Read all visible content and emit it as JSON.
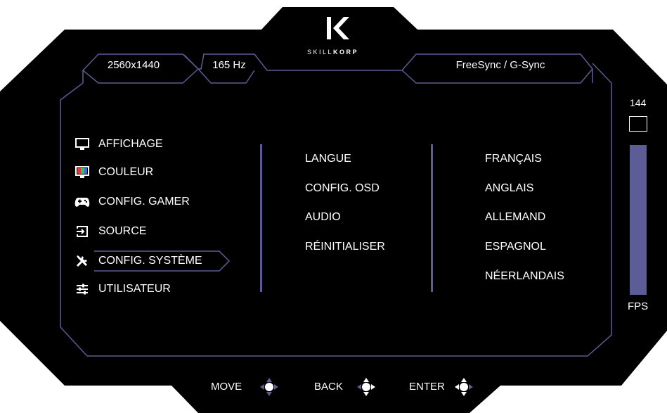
{
  "brand": {
    "name": "SKILLKORP",
    "prefix": "SKILL",
    "suffix": "KORP",
    "logo_letter": "K"
  },
  "status": {
    "resolution": "2560x1440",
    "refresh_rate": "165 Hz",
    "sync": "FreeSync / G-Sync"
  },
  "fps": {
    "max_label": "144",
    "unit_label": "FPS",
    "level": 0.92
  },
  "menu": {
    "items": [
      {
        "label": "AFFICHAGE",
        "icon": "monitor-icon"
      },
      {
        "label": "COULEUR",
        "icon": "color-icon"
      },
      {
        "label": "CONFIG. GAMER",
        "icon": "gamepad-icon"
      },
      {
        "label": "SOURCE",
        "icon": "source-icon"
      },
      {
        "label": "CONFIG. SYSTÈME",
        "icon": "tools-icon",
        "selected": true
      },
      {
        "label": "UTILISATEUR",
        "icon": "sliders-icon"
      }
    ]
  },
  "submenu": {
    "items": [
      "LANGUE",
      "CONFIG. OSD",
      "AUDIO",
      "RÉINITIALISER"
    ]
  },
  "options": {
    "items": [
      "FRANÇAIS",
      "ANGLAIS",
      "ALLEMAND",
      "ESPAGNOL",
      "NÉERLANDAIS"
    ]
  },
  "hints": {
    "move": "MOVE",
    "back": "BACK",
    "enter": "ENTER"
  },
  "colors": {
    "background": "#000000",
    "accent": "#5c5c96",
    "text": "#ffffff",
    "page": "#ffffff"
  }
}
